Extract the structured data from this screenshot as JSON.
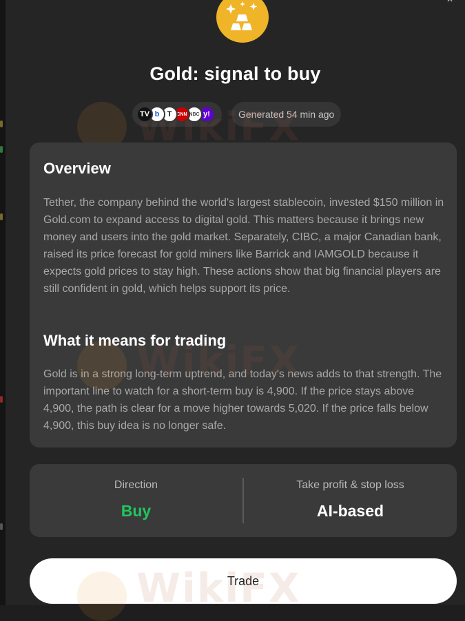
{
  "header": {
    "title": "Gold: signal to buy",
    "generated": "Generated 54 min ago",
    "close_glyph": "×"
  },
  "sources": [
    {
      "icon": "tradingview-icon",
      "glyph": "TV",
      "bg": "#111111",
      "fg": "#ffffff"
    },
    {
      "icon": "bloomberg-icon",
      "glyph": "b",
      "bg": "#ffffff",
      "fg": "#1a5bd6"
    },
    {
      "icon": "nytimes-icon",
      "glyph": "T",
      "bg": "#ffffff",
      "fg": "#111111"
    },
    {
      "icon": "cnn-icon",
      "glyph": "CNN",
      "bg": "#cc0000",
      "fg": "#ffffff"
    },
    {
      "icon": "cnbc-icon",
      "glyph": "NBC",
      "bg": "#ffffff",
      "fg": "#444444"
    },
    {
      "icon": "yahoo-icon",
      "glyph": "y!",
      "bg": "#6001d2",
      "fg": "#ffffff"
    }
  ],
  "overview": {
    "heading": "Overview",
    "text": "Tether, the company behind the world's largest stablecoin, invested $150 million in Gold.com to expand access to digital gold. This matters because it brings new money and users into the gold market. Separately, CIBC, a major Canadian bank, raised its price forecast for gold miners like Barrick and IAMGOLD because it expects gold prices to stay high. These actions show that big financial players are still confident in gold, which helps support its price."
  },
  "trading": {
    "heading": "What it means for trading",
    "text": "Gold is in a strong long-term uptrend, and today's news adds to that strength. The important line to watch for a short-term buy is 4,900. If the price stays above 4,900, the path is clear for a move higher towards 5,020. If the price falls below 4,900, this buy idea is no longer safe."
  },
  "direction": {
    "label": "Direction",
    "value": "Buy"
  },
  "tp_sl": {
    "label": "Take profit & stop loss",
    "value": "AI-based"
  },
  "trade_button": "Trade",
  "watermark": "WikiFX",
  "colors": {
    "buy": "#22c55e",
    "gold_icon": "#f0b429",
    "panel": "#252526",
    "card": "#3a3a3b"
  }
}
